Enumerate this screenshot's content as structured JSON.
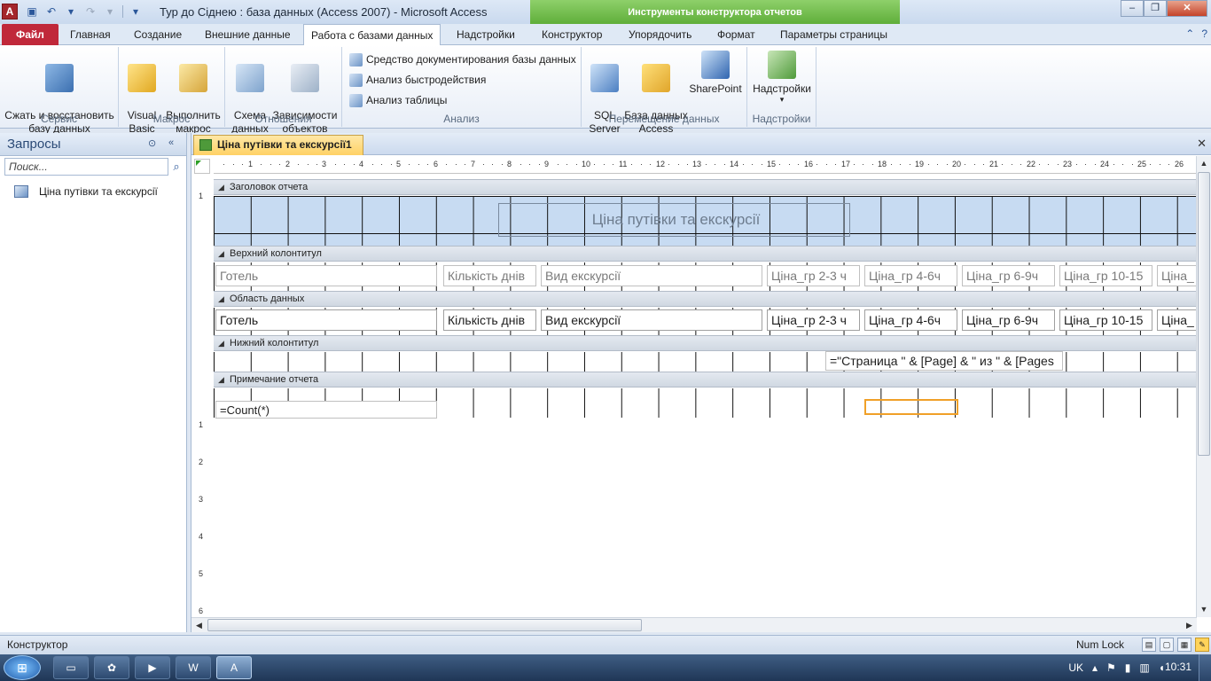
{
  "window": {
    "title": "Тур до Сіднею : база данных (Access 2007)  -  Microsoft Access",
    "context_band": "Инструменты конструктора отчетов",
    "app_icon_letter": "A"
  },
  "tabs": [
    "Файл",
    "Главная",
    "Создание",
    "Внешние данные",
    "Работа с базами данных",
    "Надстройки",
    "Конструктор",
    "Упорядочить",
    "Формат",
    "Параметры страницы"
  ],
  "ribbon": {
    "groups": {
      "service": {
        "label": "Сервис",
        "compact": "Сжать и восстановить\nбазу данных"
      },
      "macro": {
        "label": "Макрос",
        "vb": "Visual\nBasic",
        "run": "Выполнить\nмакрос"
      },
      "relations": {
        "label": "Отношения",
        "schema": "Схема\nданных",
        "deps": "Зависимости\nобъектов"
      },
      "analysis": {
        "label": "Анализ",
        "doc": "Средство документирования базы данных",
        "perf": "Анализ быстродействия",
        "table": "Анализ таблицы"
      },
      "move": {
        "label": "Перемещение данных",
        "sql": "SQL\nServer",
        "db": "База данных\nAccess",
        "sp": "SharePoint"
      },
      "addins": {
        "label": "Надстройки",
        "addins": "Надстройки"
      }
    }
  },
  "navpane": {
    "title": "Запросы",
    "search_placeholder": "Поиск...",
    "items": [
      "Ціна путівки та екскурсії"
    ]
  },
  "document": {
    "tab_title": "Ціна путівки та екскурсії1",
    "ruler_h": [
      "1",
      "2",
      "3",
      "4",
      "5",
      "6",
      "7",
      "8",
      "9",
      "10",
      "11",
      "12",
      "13",
      "14",
      "15",
      "16",
      "17",
      "18",
      "19",
      "20",
      "21",
      "22",
      "23",
      "24",
      "25",
      "26"
    ],
    "ruler_v": [
      "1",
      "1",
      "2",
      "3",
      "4",
      "5",
      "6"
    ],
    "sections": {
      "report_header": "Заголовок отчета",
      "page_header": "Верхний колонтитул",
      "detail": "Область данных",
      "page_footer": "Нижний колонтитул",
      "report_footer": "Примечание отчета"
    },
    "report_title": "Ціна путівки та екскурсії",
    "page_header_labels": [
      "Готель",
      "Кількість днів",
      "Вид екскурсії",
      "Ціна_гр 2-3 ч",
      "Ціна_гр 4-6ч",
      "Ціна_гр 6-9ч",
      "Ціна_гр 10-15",
      "Ціна_"
    ],
    "detail_fields": [
      "Готель",
      "Кількість днів",
      "Вид екскурсії",
      "Ціна_гр 2-3 ч",
      "Ціна_гр 4-6ч",
      "Ціна_гр 6-9ч",
      "Ціна_гр 10-15",
      "Ціна_"
    ],
    "page_footer_expr": "=\"Страница \" & [Page] & \" из \" & [Pages",
    "report_footer_expr": "=Count(*)"
  },
  "statusbar": {
    "left": "Конструктор",
    "numlock": "Num Lock"
  },
  "taskbar": {
    "lang": "UK",
    "time": "10:31",
    "word_label": "W",
    "access_label": "A"
  },
  "colors": {
    "file_tab": "#c0283a",
    "context_band": "#6fbf4a",
    "accent": "#2b579a"
  }
}
